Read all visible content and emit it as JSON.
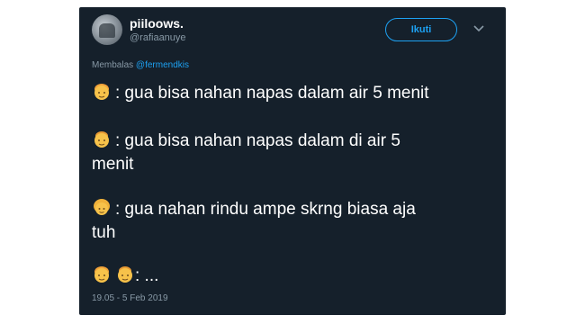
{
  "tweet": {
    "display_name": "piiloows.",
    "username": "@rafiaanuye",
    "follow_label": "Ikuti",
    "reply_prefix": "Membalas",
    "reply_handle": "@fermendkis",
    "lines": [
      ": gua bisa nahan napas dalam air 5 menit",
      ": gua bisa nahan napas dalam di air 5",
      "menit",
      ": gua nahan rindu ampe skrng biasa aja",
      "tuh",
      ": ..."
    ],
    "timestamp": "19.05 - 5 Feb 2019"
  },
  "icons": {
    "avatar": "profile-photo",
    "chevron": "chevron-down-icon",
    "emoji_1": "face-emoji",
    "emoji_2": "face-emoji",
    "emoji_3": "face-emoji",
    "emoji_4a": "face-emoji",
    "emoji_4b": "face-emoji"
  },
  "colors": {
    "background": "#15202b",
    "text": "#ffffff",
    "muted": "#8899a6",
    "accent": "#1da1f2",
    "emoji_skin": "#f7c24a"
  }
}
